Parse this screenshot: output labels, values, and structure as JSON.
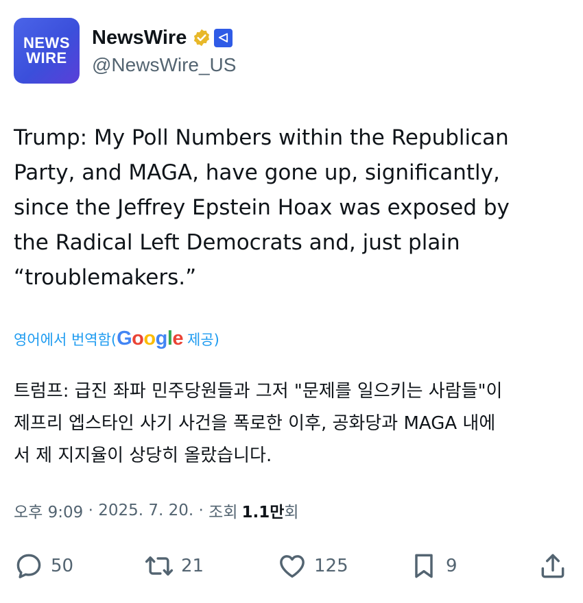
{
  "account": {
    "avatar_line1": "NEWS",
    "avatar_line2": "WIRE",
    "display_name": "NewsWire",
    "handle": "@NewsWire_US",
    "verified_color": "#e8b829",
    "affiliate_color": "#2f5be6"
  },
  "tweet": {
    "text": "Trump: My Poll Numbers within the Republican\nParty, and MAGA, have gone up, significantly,\nsince the Jeffrey Epstein Hoax was exposed by\nthe Radical Left Democrats and, just plain\n“troublemakers.”"
  },
  "translation": {
    "prefix": "영어에서 번역함(",
    "provider": "Google",
    "suffix": " 제공)",
    "text": "트럼프: 급진 좌파 민주당원들과 그저 \"문제를 일으키는 사람들\"이\n제프리 엡스타인 사기 사건을 폭로한 이후, 공화당과 MAGA 내에\n서 제 지지율이 상당히 올랐습니다."
  },
  "meta": {
    "time": "오후 9:09",
    "separator1": " · ",
    "date": "2025. 7. 20.",
    "separator2": " · ",
    "views_label": "조회",
    "views_number": "1.1만",
    "views_suffix": "회"
  },
  "actions": {
    "reply_icon": "reply-icon",
    "reply_count": "50",
    "retweet_icon": "retweet-icon",
    "retweet_count": "21",
    "like_icon": "heart-icon",
    "like_count": "125",
    "bookmark_icon": "bookmark-icon",
    "bookmark_count": "9",
    "share_icon": "share-icon"
  }
}
